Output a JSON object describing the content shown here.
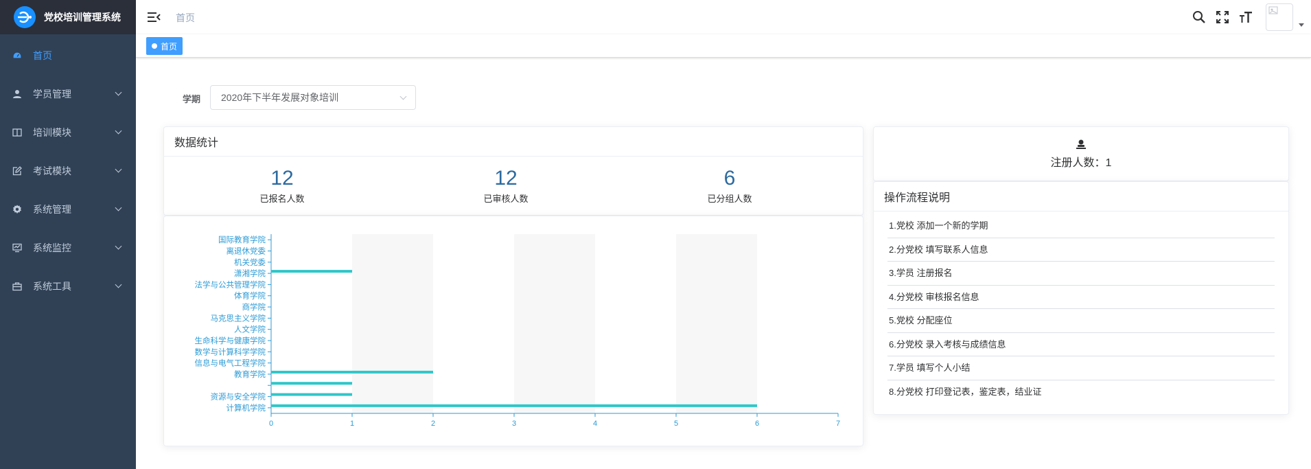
{
  "app": {
    "title": "党校培训管理系统",
    "logo_text": "Ə"
  },
  "sidebar": {
    "items": [
      {
        "label": "首页",
        "icon": "dashboard-icon",
        "active": true,
        "has_children": false
      },
      {
        "label": "学员管理",
        "icon": "user-icon",
        "active": false,
        "has_children": true
      },
      {
        "label": "培训模块",
        "icon": "book-icon",
        "active": false,
        "has_children": true
      },
      {
        "label": "考试模块",
        "icon": "edit-icon",
        "active": false,
        "has_children": true
      },
      {
        "label": "系统管理",
        "icon": "gear-icon",
        "active": false,
        "has_children": true
      },
      {
        "label": "系统监控",
        "icon": "monitor-icon",
        "active": false,
        "has_children": true
      },
      {
        "label": "系统工具",
        "icon": "toolbox-icon",
        "active": false,
        "has_children": true
      }
    ]
  },
  "header": {
    "breadcrumb": "首页",
    "icons": [
      "search-icon",
      "fullscreen-icon",
      "font-size-icon"
    ]
  },
  "tags": [
    {
      "label": "首页",
      "active": true
    }
  ],
  "filter": {
    "label": "学期",
    "value": "2020年下半年发展对象培训"
  },
  "stats": {
    "title": "数据统计",
    "items": [
      {
        "value": "12",
        "label": "已报名人数"
      },
      {
        "value": "12",
        "label": "已审核人数"
      },
      {
        "value": "6",
        "label": "已分组人数"
      }
    ]
  },
  "registration": {
    "text": "注册人数：1"
  },
  "flow": {
    "title": "操作流程说明",
    "steps": [
      "1.党校 添加一个新的学期",
      "2.分党校 填写联系人信息",
      "3.学员 注册报名",
      "4.分党校 审核报名信息",
      "5.党校 分配座位",
      "6.分党校 录入考核与成绩信息",
      "7.学员 填写个人小结",
      "8.分党校 打印登记表，鉴定表，结业证"
    ]
  },
  "colors": {
    "accent": "#409eff",
    "bar": "#2ec7c9",
    "sidebar_bg": "#304156",
    "axis": "#2c9bd6"
  },
  "chart_data": {
    "type": "bar",
    "orientation": "horizontal",
    "categories": [
      "计算机学院",
      "资源与安全学院",
      "",
      "教育学院",
      "信息与电气工程学院",
      "数学与计算科学学院",
      "生命科学与健康学院",
      "人文学院",
      "马克思主义学院",
      "商学院",
      "体育学院",
      "法学与公共管理学院",
      "潇湘学院",
      "机关党委",
      "离退休党委",
      "国际教育学院"
    ],
    "series": [
      {
        "values": [
          6,
          1,
          1,
          2,
          0,
          0,
          0,
          0,
          0,
          0,
          0,
          0,
          1,
          0,
          0,
          0
        ]
      },
      {
        "values": [
          0,
          0,
          0,
          0,
          0,
          0,
          0,
          0,
          0,
          0,
          0,
          0,
          0,
          0,
          0,
          0
        ]
      }
    ],
    "xlim": [
      0,
      7
    ],
    "xticks": [
      0,
      1,
      2,
      3,
      4,
      5,
      6,
      7
    ],
    "grid": false,
    "split_area": true
  }
}
